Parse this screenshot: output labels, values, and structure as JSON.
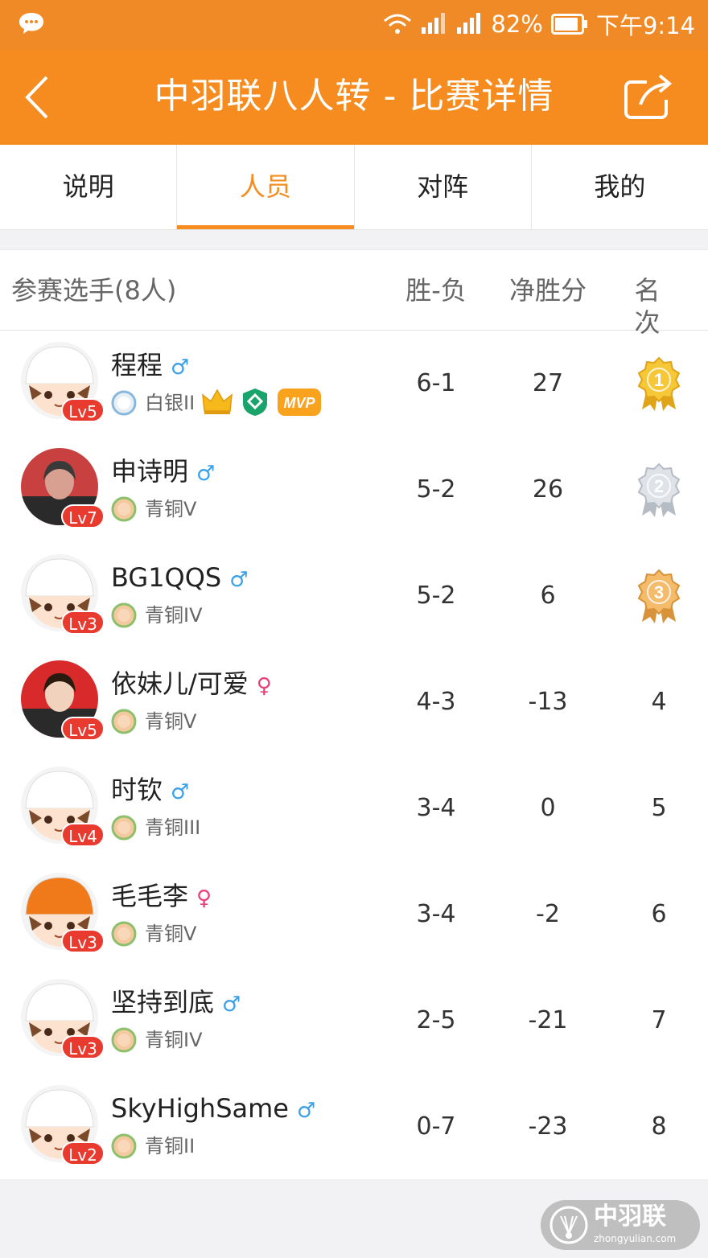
{
  "status_bar": {
    "battery": "82%",
    "time": "下午9:14",
    "icons": [
      "message-icon",
      "wifi-icon",
      "signal-icon",
      "signal-icon",
      "battery-icon"
    ]
  },
  "nav": {
    "title": "中羽联八人转 - 比赛详情",
    "back_icon": "back-arrow-icon",
    "share_icon": "share-icon"
  },
  "tabs": [
    {
      "label": "说明"
    },
    {
      "label": "人员",
      "active": true
    },
    {
      "label": "对阵"
    },
    {
      "label": "我的"
    }
  ],
  "table": {
    "headers": {
      "players": "参赛选手(8人)",
      "win_loss": "胜-负",
      "net": "净胜分",
      "rank": "名次"
    },
    "players": [
      {
        "name": "程程",
        "gender": "♂",
        "level": "Lv5",
        "tier": "白银II",
        "win_loss": "6-1",
        "net": "27",
        "rank": "1",
        "medal": "gold",
        "badges": [
          "crown-icon",
          "shield-icon",
          "MVP"
        ]
      },
      {
        "name": "申诗明",
        "gender": "♂",
        "level": "Lv7",
        "tier": "青铜V",
        "win_loss": "5-2",
        "net": "26",
        "rank": "2",
        "medal": "silver"
      },
      {
        "name": "BG1QQS",
        "gender": "♂",
        "level": "Lv3",
        "tier": "青铜IV",
        "win_loss": "5-2",
        "net": "6",
        "rank": "3",
        "medal": "bronze"
      },
      {
        "name": "依妹儿/可爱",
        "gender": "♀",
        "level": "Lv5",
        "tier": "青铜V",
        "win_loss": "4-3",
        "net": "-13",
        "rank": "4"
      },
      {
        "name": "时钦",
        "gender": "♂",
        "level": "Lv4",
        "tier": "青铜III",
        "win_loss": "3-4",
        "net": "0",
        "rank": "5"
      },
      {
        "name": "毛毛李",
        "gender": "♀",
        "level": "Lv3",
        "tier": "青铜V",
        "win_loss": "3-4",
        "net": "-2",
        "rank": "6"
      },
      {
        "name": "坚持到底",
        "gender": "♂",
        "level": "Lv3",
        "tier": "青铜IV",
        "win_loss": "2-5",
        "net": "-21",
        "rank": "7"
      },
      {
        "name": "SkyHighSame",
        "gender": "♂",
        "level": "Lv2",
        "tier": "青铜II",
        "win_loss": "0-7",
        "net": "-23",
        "rank": "8"
      }
    ]
  },
  "watermark": {
    "text": "中羽联",
    "url": "zhongyulian.com"
  },
  "colors": {
    "accent": "#f68c1f",
    "level_badge": "#e83a2e",
    "male": "#3aa0e8",
    "female": "#e8407a"
  }
}
